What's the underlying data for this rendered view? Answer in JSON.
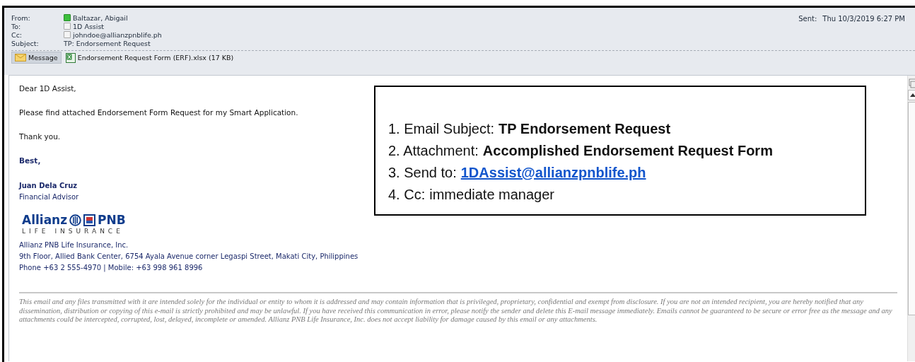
{
  "header": {
    "fields": [
      {
        "label": "From:",
        "value": "Baltazar, Abigail",
        "online": true
      },
      {
        "label": "To:",
        "value": "1D Assist",
        "online": false
      },
      {
        "label": "Cc:",
        "value": "johndoe@allianzpnblife.ph",
        "online": false
      },
      {
        "label": "Subject:",
        "value": "TP: Endorsement Request"
      }
    ],
    "sent_label": "Sent:",
    "sent_value": "Thu 10/3/2019 6:27 PM",
    "tabs": [
      {
        "label": "Message",
        "kind": "message",
        "selected": true
      },
      {
        "label": "Endorsement Request Form (ERF).xlsx (17 KB)",
        "kind": "spreadsheet",
        "selected": false
      }
    ]
  },
  "body": {
    "greeting": "Dear 1D Assist,",
    "paragraph": "Please find attached Endorsement Form Request for my Smart Application.",
    "thanks": "Thank you.",
    "closing": "Best,",
    "signature": {
      "name": "Juan Dela Cruz",
      "title": "Financial Advisor",
      "logo_top": "Allianz",
      "logo_brand": "PNB",
      "logo_bottom": "LIFE INSURANCE",
      "company": "Allianz PNB Life Insurance, Inc.",
      "address": "9th Floor, Allied Bank Center, 6754 Ayala Avenue corner Legaspi Street, Makati City, Philippines",
      "phone": "Phone +63 2 555-4970 | Mobile: +63 998 961 8996"
    },
    "disclaimer": "This email and any files transmitted with it are intended solely for the individual or entity to whom it is addressed and may contain information that is privileged, proprietary, confidential and exempt from disclosure. If you are not an intended recipient, you are hereby notified that any dissemination, distribution or copying of this e-mail is strictly prohibited and may be unlawful. If you have received this communication in error, please notify the sender and delete this E-mail message immediately. Emails cannot be guaranteed to be secure or error free as the message and any attachments could be intercepted, corrupted, lost, delayed, incomplete or amended. Allianz PNB Life Insurance, Inc. does not accept liability for damage caused by this email or any attachments."
  },
  "callout": {
    "items": [
      {
        "label": "1. Email Subject:",
        "value": "TP Endorsement Request",
        "kind": "bold"
      },
      {
        "label": "2. Attachment:",
        "value": "Accomplished Endorsement Request Form",
        "kind": "bold"
      },
      {
        "label": "3. Send to:",
        "value": "1DAssist@allianzpnblife.ph",
        "kind": "link"
      },
      {
        "label": "4. Cc:",
        "value": "immediate manager",
        "kind": "plain"
      }
    ]
  }
}
